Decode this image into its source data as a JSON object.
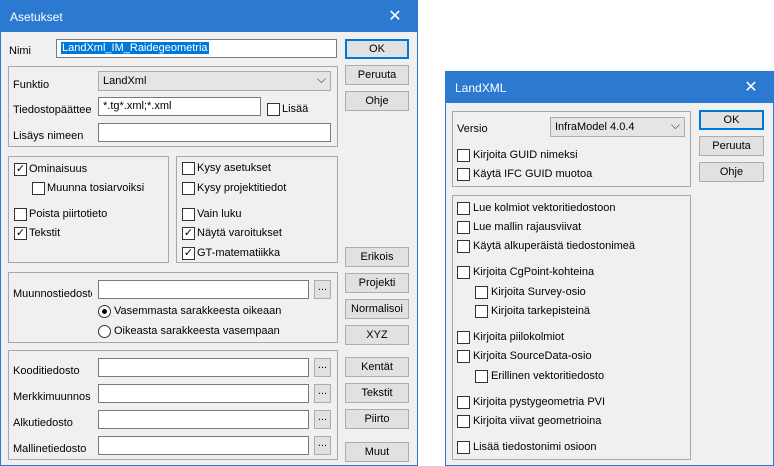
{
  "asetukset": {
    "title": "Asetukset",
    "nimi_label": "Nimi",
    "nimi_value": "LandXml_IM_Raidegeometria",
    "funktio_label": "Funktio",
    "funktio_value": "LandXml",
    "tiedostopaate_label": "Tiedostopäättee",
    "tiedostopaate_value": "*.tg*.xml;*.xml",
    "lisaa_label": "Lisää",
    "lisays_label": "Lisäys nimeen",
    "lisays_value": "",
    "checks_left": [
      {
        "label": "Ominaisuus",
        "checked": true
      },
      {
        "label": "Muunna tosiarvoiksi",
        "checked": false
      },
      {
        "label": "Poista piirtotieto",
        "checked": false
      },
      {
        "label": "Tekstit",
        "checked": true
      }
    ],
    "checks_right": [
      {
        "label": "Kysy asetukset",
        "checked": false
      },
      {
        "label": "Kysy projektitiedot",
        "checked": false
      },
      {
        "label": "Vain luku",
        "checked": false
      },
      {
        "label": "Näytä varoitukset",
        "checked": true
      },
      {
        "label": "GT-matematiikka",
        "checked": true
      }
    ],
    "muunnos_label": "Muunnostiedosto",
    "radio1": "Vasemmasta sarakkeesta oikeaan",
    "radio2": "Oikeasta sarakkeesta vasempaan",
    "koodi_label": "Kooditiedosto",
    "merkki_label": "Merkkimuunnos",
    "alku_label": "Alkutiedosto",
    "malline_label": "Mallinetiedosto",
    "browse": "...",
    "buttons": {
      "ok": "OK",
      "peruuta": "Peruuta",
      "ohje": "Ohje",
      "erikois": "Erikois",
      "projekti": "Projekti",
      "normalisoi": "Normalisoi",
      "xyz": "XYZ",
      "kentat": "Kentät",
      "tekstit": "Tekstit",
      "piirto": "Piirto",
      "muut": "Muut"
    }
  },
  "landxml": {
    "title": "LandXML",
    "versio_label": "Versio",
    "versio_value": "InfraModel 4.0.4",
    "checks_top": [
      {
        "label": "Kirjoita GUID nimeksi",
        "checked": false
      },
      {
        "label": "Käytä IFC GUID muotoa",
        "checked": false
      }
    ],
    "checks_main": [
      {
        "label": "Lue kolmiot vektoritiedostoon",
        "checked": false
      },
      {
        "label": "Lue mallin rajausviivat",
        "checked": false
      },
      {
        "label": "Käytä alkuperäistä tiedostonimeä",
        "checked": false
      },
      {
        "label": "Kirjoita CgPoint-kohteina",
        "checked": false
      },
      {
        "label": "Kirjoita Survey-osio",
        "checked": false
      },
      {
        "label": "Kirjoita tarkepisteinä",
        "checked": false
      },
      {
        "label": "Kirjoita piilokolmiot",
        "checked": false
      },
      {
        "label": "Kirjoita SourceData-osio",
        "checked": false
      },
      {
        "label": "Erillinen vektoritiedosto",
        "checked": false
      },
      {
        "label": "Kirjoita pystygeometria PVI",
        "checked": false
      },
      {
        "label": "Kirjoita viivat geometrioina",
        "checked": false
      },
      {
        "label": "Lisää tiedostonimi osioon",
        "checked": false
      }
    ],
    "buttons": {
      "ok": "OK",
      "peruuta": "Peruuta",
      "ohje": "Ohje"
    }
  },
  "icons": {
    "close": "close-icon",
    "dropdown": "chevron-down-icon"
  }
}
